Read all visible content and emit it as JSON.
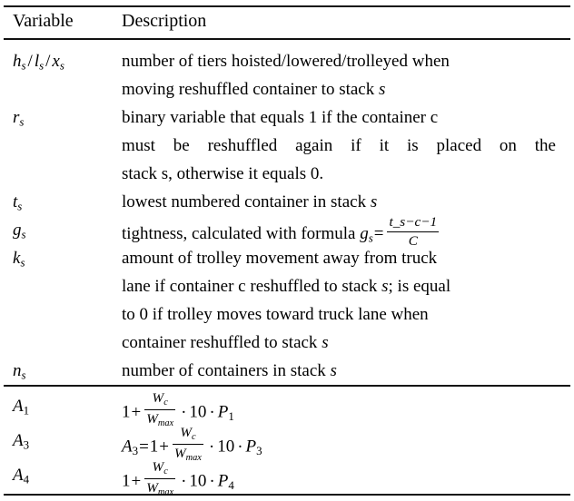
{
  "table": {
    "headers": {
      "variable": "Variable",
      "description": "Description"
    },
    "rows": [
      {
        "id": "h-l-x",
        "variable_plain": "h_s / l_s / x_s",
        "lines": [
          "number of tiers hoisted/lowered/trolleyed when",
          "moving reshuffled container to stack s"
        ]
      },
      {
        "id": "r",
        "variable_plain": "r_s",
        "lines": [
          "binary variable that equals 1 if the container c",
          "must be reshuffled again if it is placed on the",
          "stack s, otherwise it equals 0."
        ]
      },
      {
        "id": "t",
        "variable_plain": "t_s",
        "lines": [
          "lowest numbered container in stack s"
        ]
      },
      {
        "id": "g",
        "variable_plain": "g_s",
        "lines": [
          "tightness, calculated with formula g_s = (t_s - c - 1) / C"
        ],
        "formula": {
          "lead": "tightness, calculated with formula",
          "lhs": "g",
          "lhs_sub": "s",
          "equals": "=",
          "numerator": "t_s−c−1",
          "denominator": "C"
        }
      },
      {
        "id": "k",
        "variable_plain": "k_s",
        "lines": [
          "amount of trolley movement away from truck",
          "lane if container c reshuffled to stack s; is equal",
          "to 0 if trolley moves toward truck lane when",
          "container reshuffled to stack s"
        ]
      },
      {
        "id": "n",
        "variable_plain": "n_s",
        "lines": [
          "number of containers in stack s"
        ]
      }
    ],
    "formula_rows": [
      {
        "id": "A1",
        "variable_plain": "A_1",
        "var_base": "A",
        "var_sub": "1",
        "expression_plain": "1 + (W_c / W_max) · 10 · P_1",
        "prefix": "",
        "one": "1",
        "plus": "+",
        "num": "W",
        "num_sub": "c",
        "den": "W",
        "den_sub": "max",
        "times1": "·",
        "ten": "10",
        "times2": "·",
        "p": "P",
        "p_sub": "1"
      },
      {
        "id": "A3",
        "variable_plain": "A_3",
        "var_base": "A",
        "var_sub": "3",
        "expression_plain": "A_3 = 1 + (W_c / W_max) · 10 · P_3",
        "prefix": "A",
        "prefix_sub": "3",
        "equals": "=",
        "one": "1",
        "plus": "+",
        "num": "W",
        "num_sub": "c",
        "den": "W",
        "den_sub": "max",
        "times1": "·",
        "ten": "10",
        "times2": "·",
        "p": "P",
        "p_sub": "3"
      },
      {
        "id": "A4",
        "variable_plain": "A_4",
        "var_base": "A",
        "var_sub": "4",
        "expression_plain": "1 + (W_c / W_max) · 10 · P_4",
        "prefix": "",
        "one": "1",
        "plus": "+",
        "num": "W",
        "num_sub": "c",
        "den": "W",
        "den_sub": "max",
        "times1": "·",
        "ten": "10",
        "times2": "·",
        "p": "P",
        "p_sub": "4"
      }
    ]
  },
  "symbols": {
    "h": "h",
    "l": "l",
    "x": "x",
    "r": "r",
    "t": "t",
    "g": "g",
    "k": "k",
    "n": "n",
    "s": "s",
    "sep": "/"
  }
}
